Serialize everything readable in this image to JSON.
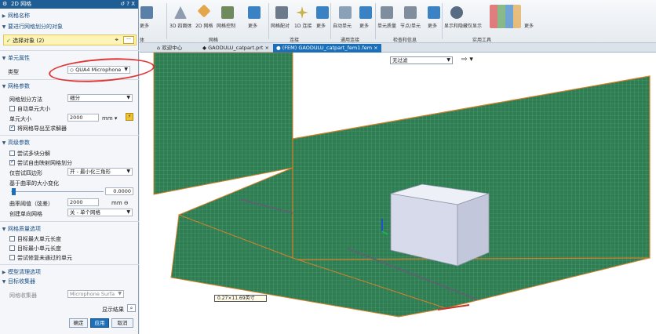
{
  "ribbon": {
    "groups": [
      {
        "name": "体",
        "items": [
          "更多"
        ]
      },
      {
        "name": "网格",
        "items": [
          "3D 四面体",
          "2D 网格",
          "网格控制",
          "更多"
        ]
      },
      {
        "name": "连接",
        "items": [
          "网格配对",
          "1D 连接",
          "更多"
        ]
      },
      {
        "name": "通用连接",
        "items": [
          "自动单元",
          "更多"
        ]
      },
      {
        "name": "检查和信息",
        "items": [
          "单元质量",
          "节点/单元",
          "更多"
        ]
      },
      {
        "name": "实用工具",
        "items": [
          "显示和隐藏",
          "仅显示",
          "更多"
        ]
      }
    ]
  },
  "tabs": [
    {
      "label": "欢迎中心"
    },
    {
      "label": "GAODULU_catpart.prt"
    },
    {
      "label": "(FEM) GAODULU_catpart_fem1.fem",
      "active": true
    }
  ],
  "view_filter": "无过滤",
  "dialog": {
    "title": "2D 网格",
    "title_controls": "↺ ? X",
    "sec_mesh_name": "网格名称",
    "sec_select": "要进行网格划分的对象",
    "select_label": "选择对象 (2)",
    "sec_elem_props": "单元属性",
    "type_label": "类型",
    "type_value": "QUA4 Microphone",
    "sec_mesh_params": "网格参数",
    "method_label": "网格划分方法",
    "method_value": "细分",
    "auto_size": "自动单元大小",
    "elem_size_label": "单元大小",
    "elem_size_value": "2000",
    "elem_size_unit": "mm",
    "export_check": "将网格导出至求解器",
    "sec_advanced": "高级参数",
    "try_quad": "尝试多块分解",
    "try_mapped": "尝试自由映射网格划分",
    "quad_label": "仅尝试四边形",
    "quad_value": "开 - 最小化三角形",
    "curvature_label": "基于曲率的大小变化",
    "curvature_value": "0.0000",
    "chord_label": "曲率阈值（弦差）",
    "chord_value": "2000",
    "chord_unit": "mm",
    "single_mesh_label": "创建单向网格",
    "single_mesh_value": "关 - 单个网格",
    "sec_quality": "网格质量选项",
    "q1": "目标最大单元长度",
    "q2": "目标最小单元长度",
    "q3": "尝试修复未通过的单元",
    "sec_cleanup": "模型清理选项",
    "sec_collector": "目标收集器",
    "collector_label": "网格收集器",
    "collector_value": "Microphone Surfa",
    "show_result": "显示结果",
    "ok": "确定",
    "apply": "应用",
    "cancel": "取消"
  },
  "measure_label": "0.27×11.69英寸",
  "colors": {
    "mesh": "#2f7d52",
    "edge": "#d9822b",
    "accent": "#1a6fb8"
  }
}
